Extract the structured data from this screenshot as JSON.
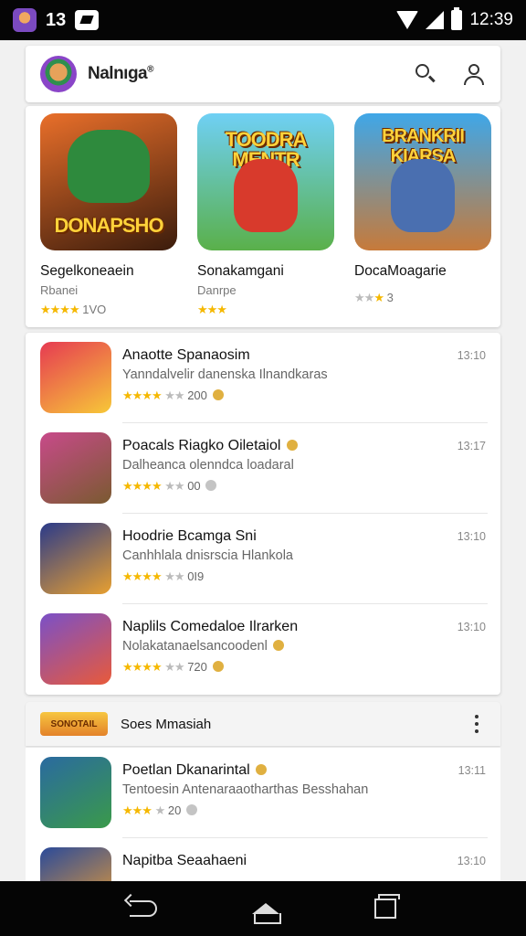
{
  "status_bar": {
    "num": "13",
    "time": "12:39"
  },
  "app_bar": {
    "title": "Nalnıga",
    "superscript": "®"
  },
  "colors": {
    "star": "#f5b800",
    "coin": "#e0b040"
  },
  "featured": [
    {
      "art_title": "DONAPSHO",
      "name": "Segelkoneaein",
      "sub": "Rbanei",
      "rating_text": "1VO",
      "art_colors": [
        "#e96f2a",
        "#3b1c0c"
      ],
      "hero": "#2e8a3d"
    },
    {
      "art_title": "TOODRA MENTR",
      "name": "Sonakamgani",
      "sub": "Danrpe",
      "rating_text": "",
      "art_colors": [
        "#6fd0f5",
        "#5ab04a"
      ],
      "hero": "#d83a2c"
    },
    {
      "art_title": "BRANKRII KIARSA",
      "name": "DocaMoagarie",
      "sub": "",
      "rating_text": "3",
      "art_colors": [
        "#3fa7e8",
        "#c77a3a"
      ],
      "hero": "#4a6fb0"
    }
  ],
  "games": [
    {
      "title": "Anaotte Spanaosim",
      "desc": "Yanndalvelir danenska Ilnandkaras",
      "reviews": "200",
      "time": "13:10",
      "thumb": [
        "#e63a52",
        "#f7c838"
      ],
      "coin": "gold"
    },
    {
      "title": "Poacals Riagko Oiletaiol",
      "desc": "Dalheanca olenndca loadaral",
      "reviews": "00",
      "time": "13:17",
      "thumb": [
        "#c84a8a",
        "#7a5a30"
      ],
      "coin": "gray"
    },
    {
      "title": "Hoodrie Bcamga Sni",
      "desc": "Canhhlala dnisrscia Hlankola",
      "reviews": "0I9",
      "time": "13:10",
      "thumb": [
        "#2a3a8a",
        "#e8a030"
      ],
      "coin": ""
    },
    {
      "title": "Naplils Comedaloe Ilrarken",
      "desc": "Nolakatanaelsancoodenl",
      "reviews": "720",
      "time": "13:10",
      "thumb": [
        "#7a50c8",
        "#e85a3a"
      ],
      "coin": "gold"
    }
  ],
  "section": {
    "logo_text": "SONOTAIL",
    "title": "Soes Mmasiah"
  },
  "games2": [
    {
      "title": "Poetlan Dkanarintal",
      "desc": "Tentoesin Antenaraaotharthas Besshahan",
      "reviews": "20",
      "time": "13:11",
      "thumb": [
        "#2a6aa0",
        "#3a9a4a"
      ],
      "coin": "gray"
    },
    {
      "title": "Napitba Seaahaeni",
      "desc": "",
      "reviews": "",
      "time": "13:10",
      "thumb": [
        "#2a4a9a",
        "#f0a030"
      ],
      "coin": ""
    }
  ]
}
